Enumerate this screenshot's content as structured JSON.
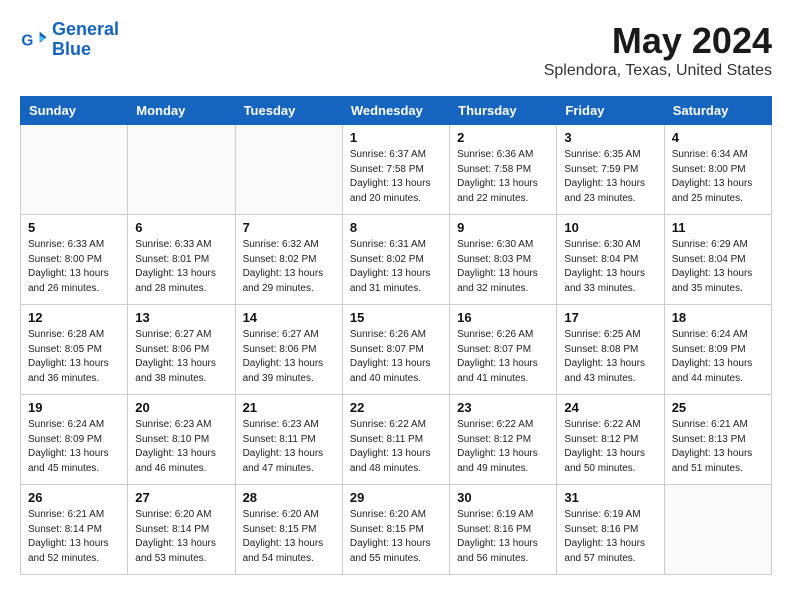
{
  "header": {
    "logo_line1": "General",
    "logo_line2": "Blue",
    "main_title": "May 2024",
    "subtitle": "Splendora, Texas, United States"
  },
  "weekdays": [
    "Sunday",
    "Monday",
    "Tuesday",
    "Wednesday",
    "Thursday",
    "Friday",
    "Saturday"
  ],
  "weeks": [
    [
      {
        "day": "",
        "info": ""
      },
      {
        "day": "",
        "info": ""
      },
      {
        "day": "",
        "info": ""
      },
      {
        "day": "1",
        "info": "Sunrise: 6:37 AM\nSunset: 7:58 PM\nDaylight: 13 hours\nand 20 minutes."
      },
      {
        "day": "2",
        "info": "Sunrise: 6:36 AM\nSunset: 7:58 PM\nDaylight: 13 hours\nand 22 minutes."
      },
      {
        "day": "3",
        "info": "Sunrise: 6:35 AM\nSunset: 7:59 PM\nDaylight: 13 hours\nand 23 minutes."
      },
      {
        "day": "4",
        "info": "Sunrise: 6:34 AM\nSunset: 8:00 PM\nDaylight: 13 hours\nand 25 minutes."
      }
    ],
    [
      {
        "day": "5",
        "info": "Sunrise: 6:33 AM\nSunset: 8:00 PM\nDaylight: 13 hours\nand 26 minutes."
      },
      {
        "day": "6",
        "info": "Sunrise: 6:33 AM\nSunset: 8:01 PM\nDaylight: 13 hours\nand 28 minutes."
      },
      {
        "day": "7",
        "info": "Sunrise: 6:32 AM\nSunset: 8:02 PM\nDaylight: 13 hours\nand 29 minutes."
      },
      {
        "day": "8",
        "info": "Sunrise: 6:31 AM\nSunset: 8:02 PM\nDaylight: 13 hours\nand 31 minutes."
      },
      {
        "day": "9",
        "info": "Sunrise: 6:30 AM\nSunset: 8:03 PM\nDaylight: 13 hours\nand 32 minutes."
      },
      {
        "day": "10",
        "info": "Sunrise: 6:30 AM\nSunset: 8:04 PM\nDaylight: 13 hours\nand 33 minutes."
      },
      {
        "day": "11",
        "info": "Sunrise: 6:29 AM\nSunset: 8:04 PM\nDaylight: 13 hours\nand 35 minutes."
      }
    ],
    [
      {
        "day": "12",
        "info": "Sunrise: 6:28 AM\nSunset: 8:05 PM\nDaylight: 13 hours\nand 36 minutes."
      },
      {
        "day": "13",
        "info": "Sunrise: 6:27 AM\nSunset: 8:06 PM\nDaylight: 13 hours\nand 38 minutes."
      },
      {
        "day": "14",
        "info": "Sunrise: 6:27 AM\nSunset: 8:06 PM\nDaylight: 13 hours\nand 39 minutes."
      },
      {
        "day": "15",
        "info": "Sunrise: 6:26 AM\nSunset: 8:07 PM\nDaylight: 13 hours\nand 40 minutes."
      },
      {
        "day": "16",
        "info": "Sunrise: 6:26 AM\nSunset: 8:07 PM\nDaylight: 13 hours\nand 41 minutes."
      },
      {
        "day": "17",
        "info": "Sunrise: 6:25 AM\nSunset: 8:08 PM\nDaylight: 13 hours\nand 43 minutes."
      },
      {
        "day": "18",
        "info": "Sunrise: 6:24 AM\nSunset: 8:09 PM\nDaylight: 13 hours\nand 44 minutes."
      }
    ],
    [
      {
        "day": "19",
        "info": "Sunrise: 6:24 AM\nSunset: 8:09 PM\nDaylight: 13 hours\nand 45 minutes."
      },
      {
        "day": "20",
        "info": "Sunrise: 6:23 AM\nSunset: 8:10 PM\nDaylight: 13 hours\nand 46 minutes."
      },
      {
        "day": "21",
        "info": "Sunrise: 6:23 AM\nSunset: 8:11 PM\nDaylight: 13 hours\nand 47 minutes."
      },
      {
        "day": "22",
        "info": "Sunrise: 6:22 AM\nSunset: 8:11 PM\nDaylight: 13 hours\nand 48 minutes."
      },
      {
        "day": "23",
        "info": "Sunrise: 6:22 AM\nSunset: 8:12 PM\nDaylight: 13 hours\nand 49 minutes."
      },
      {
        "day": "24",
        "info": "Sunrise: 6:22 AM\nSunset: 8:12 PM\nDaylight: 13 hours\nand 50 minutes."
      },
      {
        "day": "25",
        "info": "Sunrise: 6:21 AM\nSunset: 8:13 PM\nDaylight: 13 hours\nand 51 minutes."
      }
    ],
    [
      {
        "day": "26",
        "info": "Sunrise: 6:21 AM\nSunset: 8:14 PM\nDaylight: 13 hours\nand 52 minutes."
      },
      {
        "day": "27",
        "info": "Sunrise: 6:20 AM\nSunset: 8:14 PM\nDaylight: 13 hours\nand 53 minutes."
      },
      {
        "day": "28",
        "info": "Sunrise: 6:20 AM\nSunset: 8:15 PM\nDaylight: 13 hours\nand 54 minutes."
      },
      {
        "day": "29",
        "info": "Sunrise: 6:20 AM\nSunset: 8:15 PM\nDaylight: 13 hours\nand 55 minutes."
      },
      {
        "day": "30",
        "info": "Sunrise: 6:19 AM\nSunset: 8:16 PM\nDaylight: 13 hours\nand 56 minutes."
      },
      {
        "day": "31",
        "info": "Sunrise: 6:19 AM\nSunset: 8:16 PM\nDaylight: 13 hours\nand 57 minutes."
      },
      {
        "day": "",
        "info": ""
      }
    ]
  ]
}
